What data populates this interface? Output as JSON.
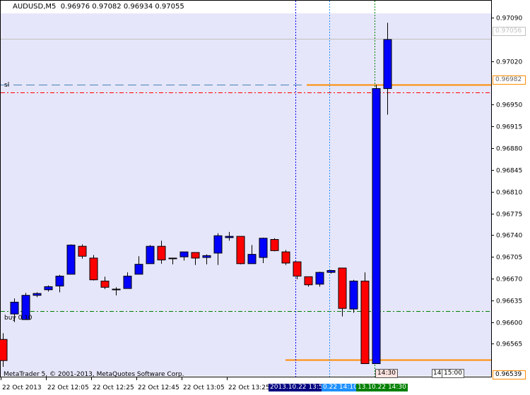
{
  "header": {
    "symbol_timeframe": "AUDUSD,M5",
    "ohlc": "0.96976 0.97082 0.96934 0.97055"
  },
  "footer": {
    "copyright": "MetaTrader 5, © 2001-2013, MetaQuotes Software Corp."
  },
  "colors": {
    "background": "#e6e6fa",
    "bull": "#0000ff",
    "bear": "#ff0000",
    "wick": "#000000",
    "ask_line": "#c0c0c0",
    "sl_line": "#ff0000",
    "buy_line": "#008000",
    "fib_orange": "#ff8c00",
    "vline_blue": "#0000ff",
    "vline_light": "#1e90ff",
    "vline_green": "#008000"
  },
  "price_labels": {
    "current": "0.97056",
    "orange_upper": "0.96982",
    "orange_lower": "0.96539"
  },
  "levels": {
    "ask_price": 0.97056,
    "sl_label": "sl",
    "sl_price": 0.9697,
    "buy_label": "buy 0.10",
    "buy_price": 0.96618,
    "orange_upper": 0.96982,
    "orange_lower": 0.96539
  },
  "time_tags": {
    "tag1": "14:30",
    "tag2": "14:",
    "tag3": "15:00"
  },
  "time_axis_highlights": [
    {
      "text": "2013.10.22 13:55",
      "color": "#000080"
    },
    {
      "text": "0.22 14:10",
      "color": "#1e90ff"
    },
    {
      "text": "13.10.22 14:30",
      "color": "#008000"
    }
  ],
  "chart_data": {
    "type": "candlestick",
    "symbol": "AUDUSD",
    "timeframe": "M5",
    "ylim": [
      0.9652,
      0.97105
    ],
    "y_ticks": [
      "0.97090",
      "0.97020",
      "0.96950",
      "0.96915",
      "0.96880",
      "0.96845",
      "0.96810",
      "0.96775",
      "0.96740",
      "0.96705",
      "0.96670",
      "0.96635",
      "0.96600",
      "0.96565"
    ],
    "x_ticks": [
      "22 Oct 2013",
      "22 Oct 12:05",
      "22 Oct 12:25",
      "22 Oct 12:45",
      "22 Oct 13:05",
      "22 Oct 13:25"
    ],
    "candles": [
      {
        "o": 0.96572,
        "h": 0.96582,
        "l": 0.96528,
        "c": 0.96538
      },
      {
        "o": 0.96613,
        "h": 0.96638,
        "l": 0.966,
        "c": 0.96632
      },
      {
        "o": 0.96604,
        "h": 0.96647,
        "l": 0.96604,
        "c": 0.96643
      },
      {
        "o": 0.96643,
        "h": 0.96648,
        "l": 0.9664,
        "c": 0.96646
      },
      {
        "o": 0.96652,
        "h": 0.96659,
        "l": 0.96649,
        "c": 0.96657
      },
      {
        "o": 0.96658,
        "h": 0.96676,
        "l": 0.96648,
        "c": 0.96674
      },
      {
        "o": 0.96677,
        "h": 0.96725,
        "l": 0.96677,
        "c": 0.96724
      },
      {
        "o": 0.96722,
        "h": 0.96725,
        "l": 0.96702,
        "c": 0.96706
      },
      {
        "o": 0.96703,
        "h": 0.96708,
        "l": 0.96667,
        "c": 0.96668
      },
      {
        "o": 0.96666,
        "h": 0.96673,
        "l": 0.96653,
        "c": 0.96656
      },
      {
        "o": 0.96653,
        "h": 0.96656,
        "l": 0.96643,
        "c": 0.96652
      },
      {
        "o": 0.96654,
        "h": 0.9668,
        "l": 0.96654,
        "c": 0.96674
      },
      {
        "o": 0.96677,
        "h": 0.96706,
        "l": 0.96677,
        "c": 0.96693
      },
      {
        "o": 0.96694,
        "h": 0.96724,
        "l": 0.96694,
        "c": 0.96722
      },
      {
        "o": 0.96722,
        "h": 0.96731,
        "l": 0.96694,
        "c": 0.967
      },
      {
        "o": 0.96703,
        "h": 0.96703,
        "l": 0.96693,
        "c": 0.96703
      },
      {
        "o": 0.96705,
        "h": 0.96712,
        "l": 0.96699,
        "c": 0.96713
      },
      {
        "o": 0.96712,
        "h": 0.96712,
        "l": 0.96692,
        "c": 0.96703
      },
      {
        "o": 0.96704,
        "h": 0.96709,
        "l": 0.96693,
        "c": 0.96707
      },
      {
        "o": 0.96711,
        "h": 0.96743,
        "l": 0.96692,
        "c": 0.96739
      },
      {
        "o": 0.96736,
        "h": 0.96745,
        "l": 0.96731,
        "c": 0.96738
      },
      {
        "o": 0.96738,
        "h": 0.96738,
        "l": 0.96693,
        "c": 0.96694
      },
      {
        "o": 0.96694,
        "h": 0.96724,
        "l": 0.96694,
        "c": 0.96709
      },
      {
        "o": 0.96704,
        "h": 0.96736,
        "l": 0.96695,
        "c": 0.96735
      },
      {
        "o": 0.96733,
        "h": 0.96735,
        "l": 0.96714,
        "c": 0.96715
      },
      {
        "o": 0.96713,
        "h": 0.96716,
        "l": 0.96692,
        "c": 0.96695
      },
      {
        "o": 0.96697,
        "h": 0.96697,
        "l": 0.96669,
        "c": 0.96674
      },
      {
        "o": 0.96673,
        "h": 0.96673,
        "l": 0.96657,
        "c": 0.9666
      },
      {
        "o": 0.96661,
        "h": 0.96681,
        "l": 0.96657,
        "c": 0.9668
      },
      {
        "o": 0.9668,
        "h": 0.96684,
        "l": 0.96678,
        "c": 0.96683
      },
      {
        "o": 0.96687,
        "h": 0.96687,
        "l": 0.96609,
        "c": 0.96622
      },
      {
        "o": 0.96621,
        "h": 0.96668,
        "l": 0.96615,
        "c": 0.96666
      },
      {
        "o": 0.96666,
        "h": 0.9668,
        "l": 0.96533,
        "c": 0.96533
      },
      {
        "o": 0.96533,
        "h": 0.96982,
        "l": 0.96533,
        "c": 0.96976
      },
      {
        "o": 0.96976,
        "h": 0.97082,
        "l": 0.96934,
        "c": 0.97055
      }
    ]
  }
}
